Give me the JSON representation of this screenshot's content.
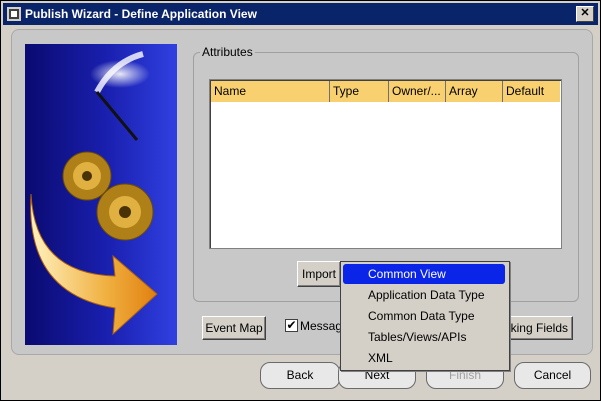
{
  "window": {
    "title": "Publish Wizard - Define Application View",
    "close_glyph": "✕"
  },
  "attributes": {
    "legend": "Attributes",
    "columns": [
      "Name",
      "Type",
      "Owner/...",
      "Array",
      "Default"
    ],
    "rows": []
  },
  "buttons": {
    "import": "Import",
    "event_map": "Event Map",
    "message_label": "Messag",
    "message_checked": true,
    "linking_fields": "king Fields"
  },
  "import_menu": {
    "items": [
      "Common View",
      "Application Data Type",
      "Common Data Type",
      "Tables/Views/APIs",
      "XML"
    ],
    "selected_index": 0
  },
  "navigation": {
    "back": "Back",
    "next": "Next",
    "finish": "Finish",
    "cancel": "Cancel"
  },
  "colors": {
    "title_bar": "#0a246a",
    "table_header": "#f8d070",
    "menu_highlight": "#0a24e8"
  }
}
